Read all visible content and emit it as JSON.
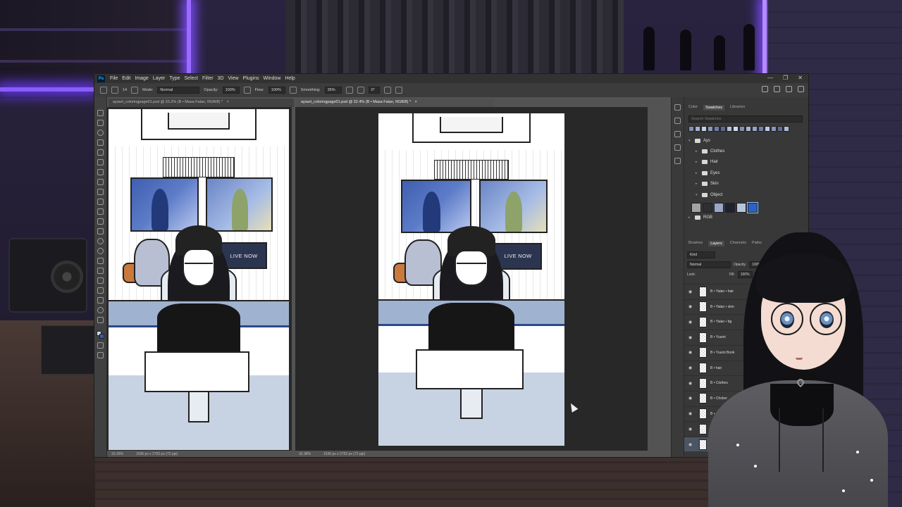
{
  "app": {
    "logo": "Ps",
    "menu": [
      "File",
      "Edit",
      "Image",
      "Layer",
      "Type",
      "Select",
      "Filter",
      "3D",
      "View",
      "Plugins",
      "Window",
      "Help"
    ],
    "window_controls": [
      "—",
      "❐",
      "✕"
    ]
  },
  "options_bar": {
    "brush_size": "14",
    "mode_label": "Mode:",
    "mode_value": "Normal",
    "opacity_label": "Opacity:",
    "opacity_value": "100%",
    "flow_label": "Flow:",
    "flow_value": "100%",
    "smoothing_label": "Smoothing:",
    "smoothing_value": "35%",
    "angle_value": "0°"
  },
  "tabs": {
    "left": "aysart_coloringpage01.psd @ 33.2% (B • Masa Falan, RGB/8) *",
    "left_close": "×",
    "right": "aysart_coloringpage01.psd @ 32.4% (B • Masa Falan, RGB/8) *",
    "right_close": "×"
  },
  "status": {
    "left_zoom": "33.29%",
    "left_dims": "1536 px x 2752 px (72 ppi)",
    "right_zoom": "32.38%",
    "right_dims": "1536 px x 2752 px (72 ppi)"
  },
  "artwork": {
    "live_text": "LIVE NOW"
  },
  "swatches_panel": {
    "tabs": [
      "Color",
      "Swatches",
      "Libraries"
    ],
    "active_tab": "Swatches",
    "search_placeholder": "Search Swatches",
    "top_colors": [
      "#7d8fb3",
      "#9fb0cf",
      "#c4d0e4",
      "#8899bb",
      "#6c7ea6",
      "#5a6b94",
      "#b5c2dc",
      "#d0d9ea",
      "#7f8fb0",
      "#a7b6d2",
      "#94a5c6",
      "#6f81a8",
      "#c0cbe0",
      "#8697bb",
      "#5e6f97",
      "#aebcd6"
    ],
    "groups": [
      {
        "label": "Ays",
        "indent": 0,
        "expanded": true
      },
      {
        "label": "Clothes",
        "indent": 1,
        "expanded": false
      },
      {
        "label": "Hair",
        "indent": 1,
        "expanded": false
      },
      {
        "label": "Eyes",
        "indent": 1,
        "expanded": false
      },
      {
        "label": "Skin",
        "indent": 1,
        "expanded": false
      },
      {
        "label": "Object",
        "indent": 1,
        "expanded": true
      }
    ],
    "object_colors": [
      "#a3a3a3",
      "#2e2e33",
      "#9ba7c8",
      "#1e2230",
      "#b7c4dc",
      "#2a63c5"
    ],
    "rgb_group": "RGB"
  },
  "layers_panel": {
    "tabs": [
      "Brushes",
      "Layers",
      "Channels",
      "Paths"
    ],
    "active_tab": "Layers",
    "kind_label": "Kind",
    "blend_mode": "Normal",
    "opacity_label": "Opacity:",
    "opacity_value": "100%",
    "lock_label": "Lock:",
    "fill_label": "Fill:",
    "fill_value": "100%",
    "layers": [
      {
        "name": "B • Yalan • hair",
        "selected": false
      },
      {
        "name": "B • Yalan • skin",
        "selected": false
      },
      {
        "name": "B • Yalan • bg",
        "selected": false
      },
      {
        "name": "B • Yuumi",
        "selected": false
      },
      {
        "name": "B • Yuumi Book",
        "selected": false
      },
      {
        "name": "B • hair",
        "selected": false
      },
      {
        "name": "B • Clothes",
        "selected": false
      },
      {
        "name": "B • Choker",
        "selected": false
      },
      {
        "name": "B • skin",
        "selected": false
      },
      {
        "name": "Layer 1",
        "selected": false
      },
      {
        "name": "B • Masa Falan",
        "selected": true
      }
    ]
  }
}
